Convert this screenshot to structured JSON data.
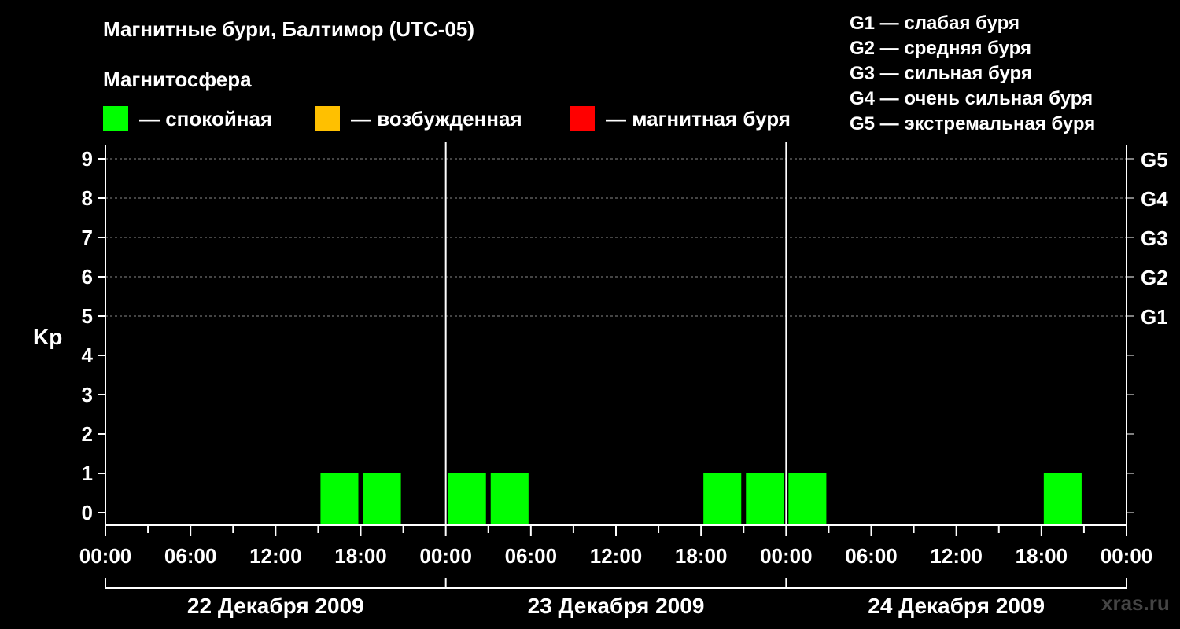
{
  "chart_data": {
    "type": "bar",
    "title": "Магнитные бури, Балтимор (UTC-05)",
    "subtitle": "Магнитосфера",
    "ylabel": "Kp",
    "ylim": [
      0,
      9
    ],
    "y_ticks": [
      "0",
      "1",
      "2",
      "3",
      "4",
      "5",
      "6",
      "7",
      "8",
      "9"
    ],
    "g_levels": [
      {
        "kp": 5,
        "label": "G1"
      },
      {
        "kp": 6,
        "label": "G2"
      },
      {
        "kp": 7,
        "label": "G3"
      },
      {
        "kp": 8,
        "label": "G4"
      },
      {
        "kp": 9,
        "label": "G5"
      }
    ],
    "x_ticks": [
      "00:00",
      "06:00",
      "12:00",
      "18:00",
      "00:00",
      "06:00",
      "12:00",
      "18:00",
      "00:00",
      "06:00",
      "12:00",
      "18:00",
      "00:00"
    ],
    "days": [
      "22 Декабря 2009",
      "23 Декабря 2009",
      "24 Декабря 2009"
    ],
    "interval_hours": 3,
    "series": [
      {
        "values": [
          0,
          0,
          0,
          0,
          0,
          1,
          1,
          0,
          1,
          1,
          0,
          0,
          0,
          0,
          1,
          1,
          1,
          0,
          0,
          0,
          0,
          0,
          1,
          0
        ]
      }
    ],
    "grid": true
  },
  "legend": {
    "quiet": {
      "label": "— спокойная",
      "color": "#00ff00"
    },
    "excited": {
      "label": "— возбужденная",
      "color": "#ffc000"
    },
    "storm": {
      "label": "— магнитная буря",
      "color": "#ff0000"
    }
  },
  "g_legend": [
    "G1 — слабая буря",
    "G2 — средняя буря",
    "G3 — сильная буря",
    "G4 — очень сильная буря",
    "G5 — экстремальная буря"
  ],
  "watermark": "xras.ru",
  "colors": {
    "background": "#000000",
    "axis": "#ffffff",
    "grid": "#888888",
    "bar": "#00ff00"
  }
}
